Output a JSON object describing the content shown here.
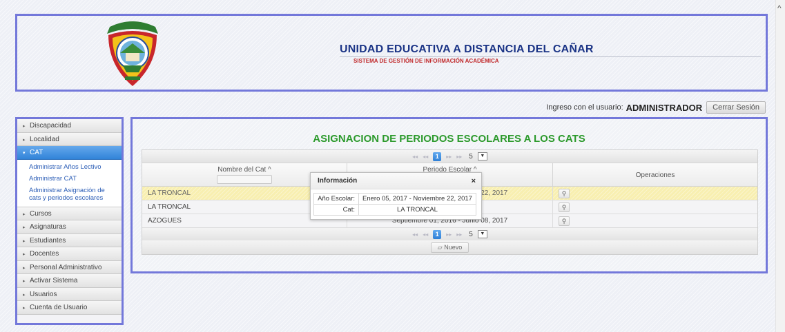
{
  "header": {
    "title": "UNIDAD EDUCATIVA A DISTANCIA DEL CAÑAR",
    "subtitle": "SISTEMA DE GESTIÓN DE INFORMACIÓN ACADÉMICA",
    "logo": "school-crest-logo"
  },
  "session": {
    "label": "Ingreso con el usuario:",
    "user": "ADMINISTRADOR",
    "logout_label": "Cerrar Sesión"
  },
  "sidebar": {
    "items": [
      {
        "label": "Discapacidad"
      },
      {
        "label": "Localidad"
      },
      {
        "label": "CAT",
        "active": true,
        "children": [
          {
            "label": "Administrar Años Lectivo"
          },
          {
            "label": "Administrar CAT"
          },
          {
            "label": "Administrar Asignación de cats y periodos escolares"
          }
        ]
      },
      {
        "label": "Cursos"
      },
      {
        "label": "Asignaturas"
      },
      {
        "label": "Estudiantes"
      },
      {
        "label": "Docentes"
      },
      {
        "label": "Personal Administrativo"
      },
      {
        "label": "Activar Sistema"
      },
      {
        "label": "Usuarios"
      },
      {
        "label": "Cuenta de Usuario"
      }
    ]
  },
  "main": {
    "title": "ASIGNACION DE PERIODOS ESCOLARES A LOS CATS",
    "columns": [
      "Nombre del Cat ^",
      "Periodo Escolar ^",
      "Operaciones"
    ],
    "rows": [
      {
        "cat": "LA TRONCAL",
        "periodo": "Enero 05, 2017 - Noviembre 22, 2017",
        "selected": true
      },
      {
        "cat": "LA TRONCAL",
        "periodo": "",
        "selected": false
      },
      {
        "cat": "AZOGUES",
        "periodo": "Septiembre 01, 2016 - Junio 08, 2017",
        "selected": false
      }
    ],
    "pager": {
      "current_page": "1",
      "rows_per_page": "5",
      "first": "◂◂",
      "prev": "◂◂",
      "next": "▸▸",
      "last": "▸▸"
    },
    "new_label": "Nuevo",
    "view_icon": "magnifier-icon"
  },
  "dialog": {
    "title": "Información",
    "close": "×",
    "rows": [
      {
        "key": "Año Escolar:",
        "value": "Enero 05, 2017 - Noviembre 22, 2017"
      },
      {
        "key": "Cat:",
        "value": "LA TRONCAL"
      }
    ]
  },
  "colors": {
    "border_accent": "#7378da",
    "title_green": "#2c9a2c",
    "header_navy": "#1b3486",
    "subtitle_red": "#c0282a",
    "menu_active": "#3183d8",
    "row_selected": "#f8efb0"
  }
}
